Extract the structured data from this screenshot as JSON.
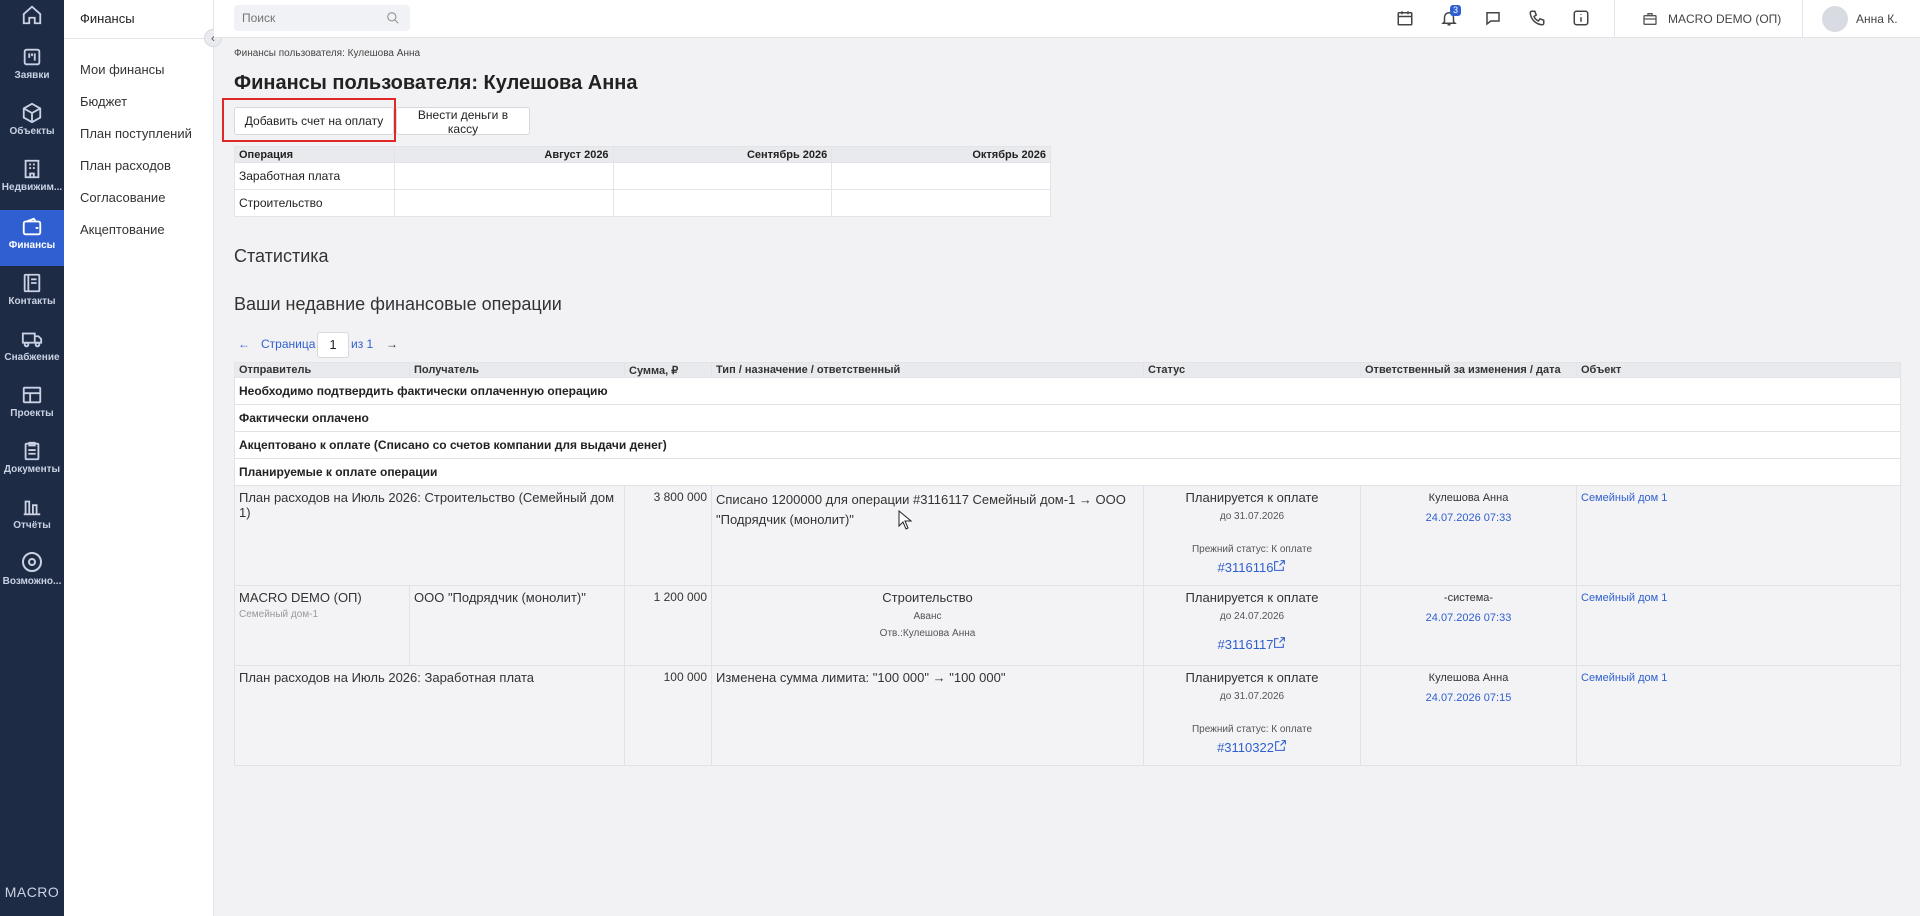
{
  "nav": {
    "items": [
      {
        "label": ""
      },
      {
        "label": "Заявки"
      },
      {
        "label": "Объекты"
      },
      {
        "label": "Недвижим..."
      },
      {
        "label": "Финансы"
      },
      {
        "label": "Контакты"
      },
      {
        "label": "Снабжение"
      },
      {
        "label": "Проекты"
      },
      {
        "label": "Документы"
      },
      {
        "label": "Отчёты"
      },
      {
        "label": "Возможно..."
      }
    ],
    "brand": "MACRO"
  },
  "sidebar": {
    "title": "Финансы",
    "items": [
      {
        "label": "Мои финансы"
      },
      {
        "label": "Бюджет"
      },
      {
        "label": "План поступлений"
      },
      {
        "label": "План расходов"
      },
      {
        "label": "Согласование"
      },
      {
        "label": "Акцептование"
      }
    ]
  },
  "topbar": {
    "search_placeholder": "Поиск",
    "notifications_count": "3",
    "company": "MACRO DEMO (ОП)",
    "user": "Анна К."
  },
  "page": {
    "breadcrumb": "Финансы пользователя: Кулешова Анна",
    "title": "Финансы пользователя: Кулешова Анна",
    "add_invoice_button": "Добавить счет на оплату",
    "deposit_button": "Внести деньги в кассу"
  },
  "budget": {
    "headers": [
      "Операция",
      "Август 2026",
      "Сентябрь 2026",
      "Октябрь 2026"
    ],
    "rows": [
      {
        "label": "Заработная плата"
      },
      {
        "label": "Строительство"
      }
    ]
  },
  "statistics_title": "Статистика",
  "recent_title": "Ваши недавние финансовые операции",
  "pager": {
    "prev": "←",
    "page_label": "Страница",
    "page": "1",
    "of_label": "из 1",
    "next": "→"
  },
  "ops": {
    "headers": [
      "Отправитель",
      "Получатель",
      "Сумма, ₽",
      "Тип / назначение / ответственный",
      "Статус",
      "Ответственный за изменения / дата",
      "Объект"
    ],
    "groups": [
      "Необходимо подтвердить фактически оплаченную операцию",
      "Фактически оплачено",
      "Акцептовано к оплате (Списано со счетов компании для выдачи денег)",
      "Планируемые к оплате операции"
    ],
    "rows": [
      {
        "sender": "План расходов на Июль 2026: Строительство (Семейный дом 1)",
        "amount": "3 800 000",
        "desc": "Списано 1200000 для операции #3116117 Семейный дом-1 → ООО \"Подрядчик (монолит)\"",
        "status": "Планируется к оплате",
        "due": "до 31.07.2026",
        "prev_status": "Прежний статус: К оплате",
        "op_link": "#3116116",
        "responsible": "Кулешова Анна",
        "date": "24.07.2026 07:33",
        "object": "Семейный дом 1"
      },
      {
        "sender": "MACRO DEMO (ОП)",
        "sender_sub": "Семейный дом-1",
        "receiver": "ООО \"Подрядчик (монолит)\"",
        "amount": "1 200 000",
        "type": "Строительство",
        "purpose": "Аванс",
        "resp_line": "Отв.:Кулешова Анна",
        "status": "Планируется к оплате",
        "due": "до 24.07.2026",
        "op_link": "#3116117",
        "responsible": "-система-",
        "date": "24.07.2026 07:33",
        "object": "Семейный дом 1"
      },
      {
        "sender": "План расходов на Июль 2026: Заработная плата",
        "amount": "100 000",
        "desc": "Изменена сумма лимита: \"100 000\" → \"100 000\"",
        "status": "Планируется к оплате",
        "due": "до 31.07.2026",
        "prev_status": "Прежний статус: К оплате",
        "op_link": "#3110322",
        "responsible": "Кулешова Анна",
        "date": "24.07.2026 07:15",
        "object": "Семейный дом 1"
      }
    ]
  },
  "colors": {
    "accent": "#2f5fd0",
    "nav_bg": "#1e2b45",
    "highlight": "#e0272a"
  }
}
